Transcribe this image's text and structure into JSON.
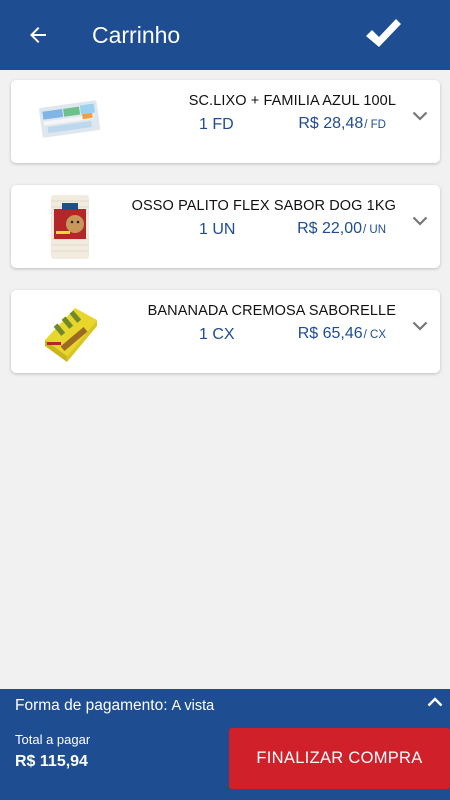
{
  "header": {
    "title": "Carrinho",
    "back_icon": "arrow-left-icon",
    "confirm_icon": "checkmark-icon",
    "background": "#1e4d92"
  },
  "items": [
    {
      "name": "SC.LIXO + FAMILIA AZUL 100L",
      "quantity": "1 FD",
      "price": "R$ 28,48",
      "unit": "/ FD",
      "image_icon": "trash-bags-product-image"
    },
    {
      "name": "OSSO PALITO FLEX SABOR DOG 1KG",
      "quantity": "1 UN",
      "price": "R$ 22,00",
      "unit": "/ UN",
      "image_icon": "dog-treat-product-image"
    },
    {
      "name": "BANANADA CREMOSA SABORELLE",
      "quantity": "1 CX",
      "price": "R$ 65,46",
      "unit": "/ CX",
      "image_icon": "candy-box-product-image"
    }
  ],
  "footer": {
    "payment_label": "Forma de pagamento:",
    "payment_value": "A vista",
    "total_label": "Total a pagar",
    "total_value": "R$ 115,94",
    "finish_button": "FINALIZAR COMPRA",
    "finish_color": "#d0202a"
  }
}
